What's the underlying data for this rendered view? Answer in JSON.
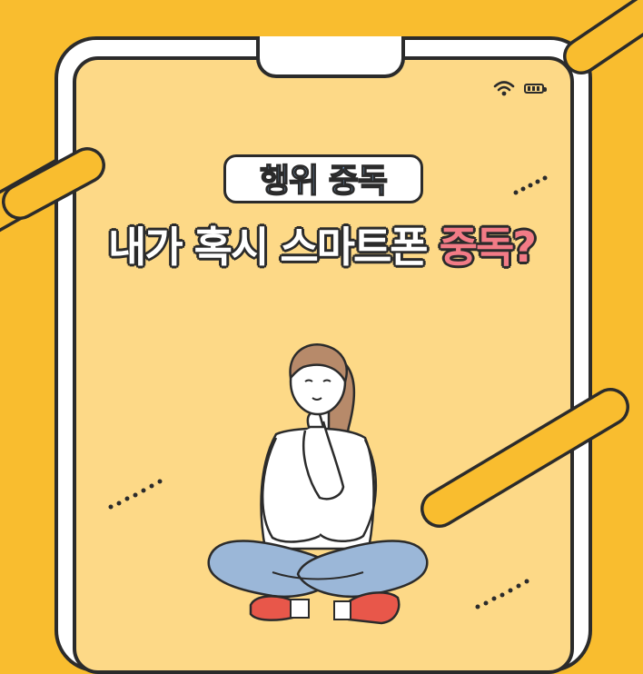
{
  "header": {
    "tag_label": "행위 중독",
    "headline_main": "내가 혹시 스마트폰 ",
    "headline_accent": "중독?"
  },
  "status_bar": {
    "icons": [
      "wifi-icon",
      "battery-icon"
    ]
  },
  "illustration": {
    "subject": "woman-sitting-thinking"
  },
  "colors": {
    "background": "#f9bd2f",
    "screen": "#fdd987",
    "phone_frame": "#ffffff",
    "outline": "#2b2b2b",
    "tag_text": "#86b8ec",
    "accent_text": "#f27b86",
    "jeans": "#9bb7d8",
    "shoes": "#e8574a",
    "hair": "#b78a6a"
  }
}
